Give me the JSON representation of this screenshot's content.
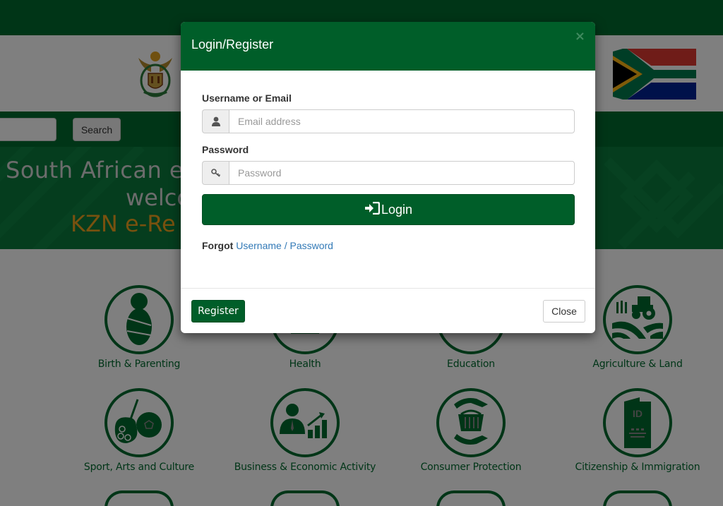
{
  "header": {
    "coat_of_arms": "south-africa-coat-of-arms",
    "flag": "south-africa-flag",
    "search_button_label": "Search",
    "search_input_value": ""
  },
  "banner": {
    "line1": "South African e",
    "line2": "welco",
    "line3": "KZN e-Re"
  },
  "services": [
    {
      "label": "Birth & Parenting",
      "icon": "swaddled-baby-icon"
    },
    {
      "label": "Health",
      "icon": "health-icon"
    },
    {
      "label": "Education",
      "icon": "education-icon"
    },
    {
      "label": "Agriculture & Land",
      "icon": "tractor-field-icon"
    },
    {
      "label": "Sport, Arts and Culture",
      "icon": "palette-soccer-ball-icon"
    },
    {
      "label": "Business & Economic Activity",
      "icon": "businessman-growth-chart-icon"
    },
    {
      "label": "Consumer Protection",
      "icon": "hands-basket-icon"
    },
    {
      "label": "Citizenship & Immigration",
      "icon": "id-document-icon"
    }
  ],
  "modal": {
    "title": "Login/Register",
    "close_symbol": "×",
    "username": {
      "label": "Username or Email",
      "placeholder": "Email address",
      "value": "",
      "icon": "user-icon"
    },
    "password": {
      "label": "Password",
      "placeholder": "Password",
      "value": "",
      "icon": "key-icon"
    },
    "login_button": {
      "label": "Login",
      "icon": "sign-in-icon"
    },
    "forgot": {
      "prefix": "Forgot",
      "username_link": "Username",
      "separator": "/",
      "password_link": "Password"
    },
    "register_button": "Register",
    "close_button": "Close"
  },
  "colors": {
    "brand_green": "#005e29",
    "link_blue": "#337ab7",
    "banner_gold": "#f0a21f"
  }
}
